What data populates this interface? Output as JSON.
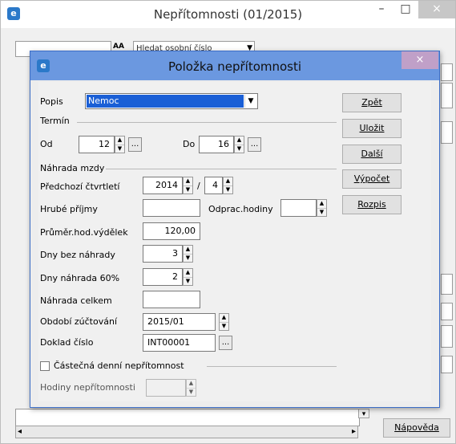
{
  "window": {
    "title": "Nepřítomnosti (01/2015)",
    "minimize": "–",
    "maximize": "□",
    "close": "×"
  },
  "background": {
    "search_field_value": "",
    "binoculars": "AA",
    "search_by_select": "Hledat osobní číslo",
    "help_button": "Nápověda"
  },
  "dialog": {
    "title": "Položka nepřítomnosti",
    "close": "×",
    "popis_label": "Popis",
    "popis_value": "Nemoc",
    "termin_label": "Termín",
    "od_label": "Od",
    "od_value": "12",
    "do_label": "Do",
    "do_value": "16",
    "dots": "...",
    "nahrada_label": "Náhrada mzdy",
    "predchozi_label": "Předchozí čtvrtletí",
    "year_value": "2014",
    "slash": "/",
    "quarter_value": "4",
    "hrube_label": "Hrubé příjmy",
    "hrube_value": "",
    "odprac_label": "Odprac.hodiny",
    "odprac_value": "",
    "prumer_label": "Průměr.hod.výdělek",
    "prumer_value": "120,00",
    "dny_bez_label": "Dny bez náhrady",
    "dny_bez_value": "3",
    "dny_60_label": "Dny náhrada 60%",
    "dny_60_value": "2",
    "nahrada_celkem_label": "Náhrada celkem",
    "nahrada_celkem_value": "",
    "obdobi_label": "Období zúčtování",
    "obdobi_value": "2015/01",
    "doklad_label": "Doklad číslo",
    "doklad_value": "INT00001",
    "castecna_label": "Částečná denní nepřítomnost",
    "castecna_checked": false,
    "hodiny_label": "Hodiny nepřítomnosti",
    "hodiny_value": "",
    "buttons": {
      "zpet": "Zpět",
      "ulozit": "Uložit",
      "dalsi": "Další",
      "vypocet": "Výpočet",
      "rozpis": "Rozpis"
    }
  }
}
